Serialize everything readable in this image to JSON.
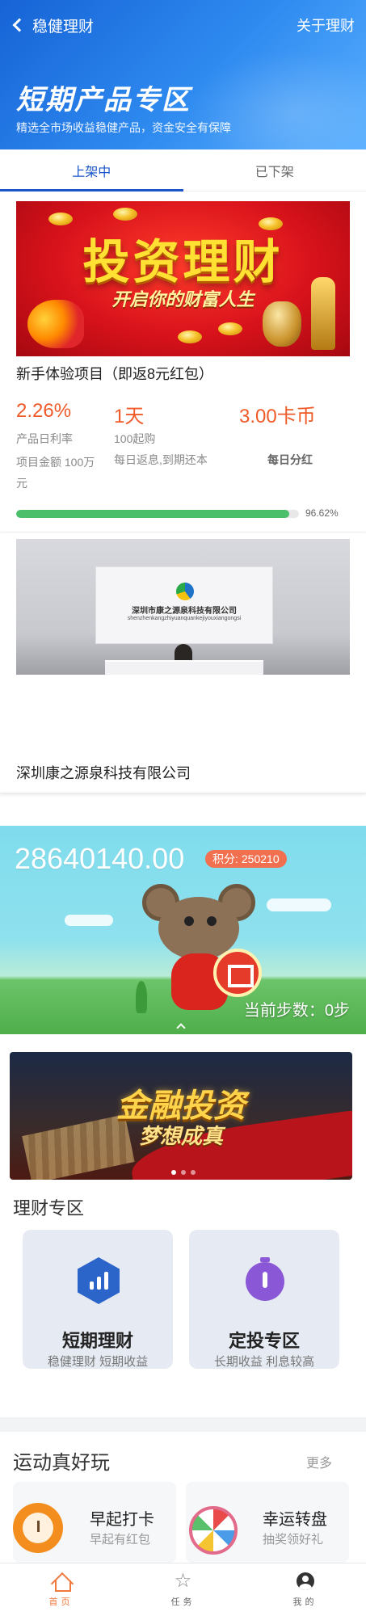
{
  "header": {
    "back_label": "稳健理财",
    "about_label": "关于理财",
    "title": "短期产品专区",
    "subtitle": "精选全市场收益稳健产品，资金安全有保障"
  },
  "tabs": [
    {
      "label": "上架中",
      "active": true
    },
    {
      "label": "已下架",
      "active": false
    }
  ],
  "product": {
    "banner_title": "投资理财",
    "banner_subtitle": "开启你的财富人生",
    "name": "新手体验项目（即返8元红包）",
    "rate": "2.26%",
    "days": "1天",
    "coin": "3.00卡币",
    "rate_label": "产品日利率",
    "min_purchase": "100起购",
    "amount_label": "项目金额 100万元",
    "repay_label": "每日返息,到期还本",
    "payout_label": "每日分红",
    "progress_percent": 96.62,
    "progress_text": "96.62%"
  },
  "company": {
    "wall_name": "深圳市康之源泉科技有限公司",
    "wall_pinyin": "shenzhenkangzhiyuanquankejiyouxiangongsi",
    "name": "深圳康之源泉科技有限公司"
  },
  "game": {
    "points_value": "28640140.00",
    "score_label": "积分:",
    "score_value": "250210",
    "steps_text": "当前步数：0步"
  },
  "finance_banner": {
    "title": "金融投资",
    "subtitle": "梦想成真",
    "slides": 3,
    "active_slide": 0
  },
  "zone": {
    "title": "理财专区",
    "cards": [
      {
        "title": "短期理财",
        "subtitle": "稳健理财 短期收益",
        "icon": "chart-hex-icon",
        "color": "#2c65c9"
      },
      {
        "title": "定投专区",
        "subtitle": "长期收益 利息较高",
        "icon": "timer-icon",
        "color": "#8a57d6"
      }
    ]
  },
  "sports": {
    "title": "运动真好玩",
    "more_label": "更多",
    "items": [
      {
        "title": "早起打卡",
        "subtitle": "早起有红包",
        "icon": "alarm-clock-icon"
      },
      {
        "title": "幸运转盘",
        "subtitle": "抽奖领好礼",
        "icon": "prize-wheel-icon"
      }
    ]
  },
  "bottom_nav": [
    {
      "label": "首页",
      "icon": "home-icon",
      "active": true
    },
    {
      "label": "任务",
      "icon": "star-icon",
      "active": false
    },
    {
      "label": "我的",
      "icon": "user-icon",
      "active": false
    }
  ],
  "colors": {
    "primary": "#1a56c9",
    "accent": "#f05a28",
    "progress": "#4cbf6b",
    "nav_active": "#f0793e"
  }
}
